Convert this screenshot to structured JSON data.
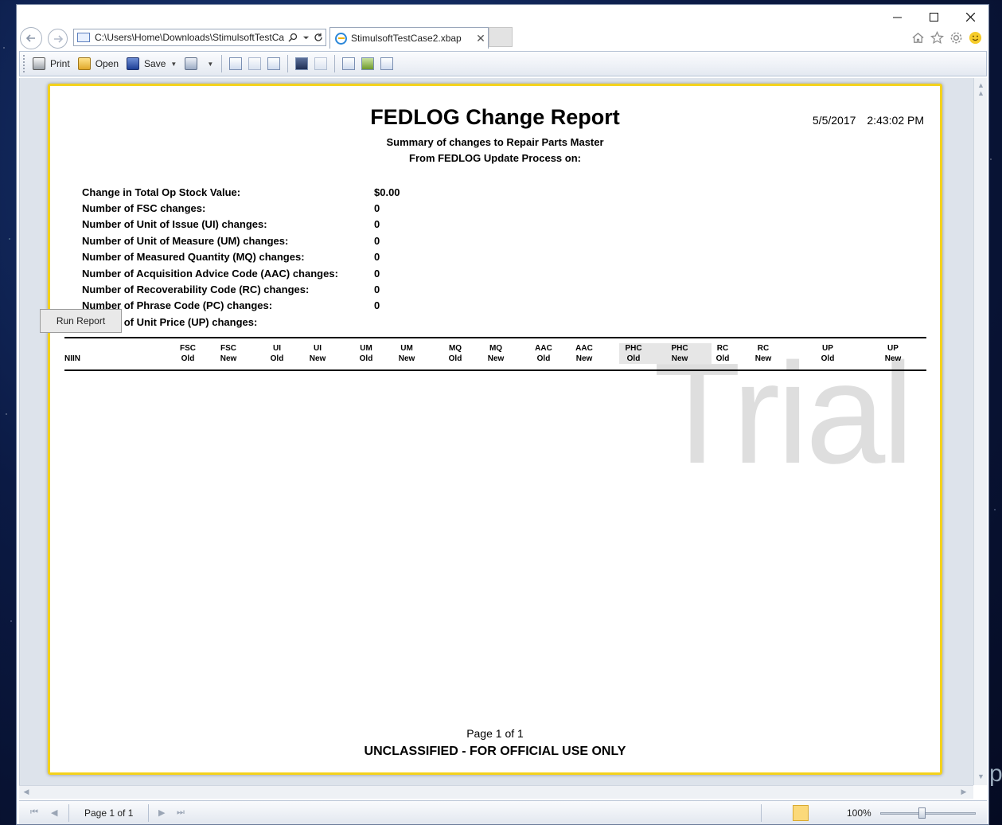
{
  "browser": {
    "address": "C:\\Users\\Home\\Downloads\\StimulsoftTestCa",
    "tab_title": "StimulsoftTestCase2.xbap",
    "tab_close": "✕"
  },
  "toolbar": {
    "print_label": "Print",
    "open_label": "Open",
    "save_label": "Save"
  },
  "report": {
    "title": "FEDLOG Change Report",
    "date": "5/5/2017",
    "time": "2:43:02 PM",
    "subtitle1": "Summary of changes to Repair Parts Master",
    "subtitle2": "From FEDLOG Update Process on:",
    "stats": [
      {
        "label": "Change in Total Op Stock Value:",
        "value": "$0.00"
      },
      {
        "label": "Number of FSC changes:",
        "value": "0"
      },
      {
        "label": "Number of Unit of Issue (UI) changes:",
        "value": "0"
      },
      {
        "label": "Number of Unit of Measure (UM) changes:",
        "value": "0"
      },
      {
        "label": "Number of Measured Quantity (MQ) changes:",
        "value": "0"
      },
      {
        "label": "Number of Acquisition Advice Code (AAC) changes:",
        "value": "0"
      },
      {
        "label": "Number of Recoverability Code (RC) changes:",
        "value": "0"
      },
      {
        "label": "Number of Phrase Code (PC) changes:",
        "value": "0"
      },
      {
        "label": "Number of Unit Price (UP) changes:",
        "value": ""
      }
    ],
    "columns": {
      "niin": "NIIN",
      "headers": [
        {
          "top": "FSC",
          "bottom": "Old"
        },
        {
          "top": "FSC",
          "bottom": "New"
        },
        {
          "top": "UI",
          "bottom": "Old"
        },
        {
          "top": "UI",
          "bottom": "New"
        },
        {
          "top": "UM",
          "bottom": "Old"
        },
        {
          "top": "UM",
          "bottom": "New"
        },
        {
          "top": "MQ",
          "bottom": "Old"
        },
        {
          "top": "MQ",
          "bottom": "New"
        },
        {
          "top": "AAC",
          "bottom": "Old"
        },
        {
          "top": "AAC",
          "bottom": "New"
        },
        {
          "top": "PHC",
          "bottom": "Old"
        },
        {
          "top": "PHC",
          "bottom": "New"
        },
        {
          "top": "RC",
          "bottom": "Old"
        },
        {
          "top": "RC",
          "bottom": "New"
        },
        {
          "top": "UP",
          "bottom": "Old"
        },
        {
          "top": "UP",
          "bottom": "New"
        }
      ]
    },
    "watermark": "Trial",
    "page_footer": "Page 1 of 1",
    "classification": "UNCLASSIFIED - FOR OFFICIAL USE ONLY"
  },
  "run_report_label": "Run Report",
  "statusbar": {
    "page_label": "Page 1 of 1",
    "zoom": "100%"
  },
  "colors": {
    "page_border": "#f4d21c",
    "viewer_bg": "#dde3eb"
  }
}
